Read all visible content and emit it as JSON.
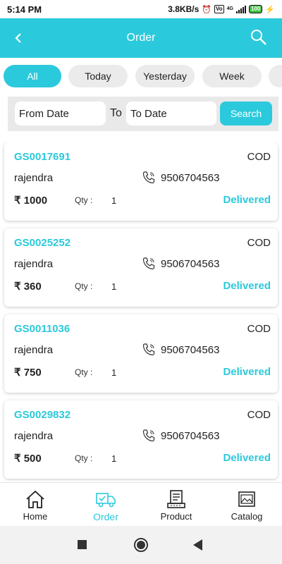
{
  "status_bar": {
    "time": "5:14 PM",
    "network_speed": "3.8KB/s",
    "volte": "Vo",
    "network": "4G",
    "battery": "100"
  },
  "app_bar": {
    "title": "Order",
    "back_icon": "arrow-left-icon",
    "search_icon": "search-icon"
  },
  "filters": [
    "All",
    "Today",
    "Yesterday",
    "Week"
  ],
  "date_filter": {
    "from_placeholder": "From Date",
    "to_separator": "To",
    "to_placeholder": "To Date",
    "search_label": "Search"
  },
  "orders": [
    {
      "id": "GS0017691",
      "payment": "COD",
      "customer": "rajendra",
      "phone": "9506704563",
      "amount": "₹ 1000",
      "qty_label": "Qty :",
      "qty": "1",
      "status": "Delivered"
    },
    {
      "id": "GS0025252",
      "payment": "COD",
      "customer": "rajendra",
      "phone": "9506704563",
      "amount": "₹ 360",
      "qty_label": "Qty :",
      "qty": "1",
      "status": "Delivered"
    },
    {
      "id": "GS0011036",
      "payment": "COD",
      "customer": "rajendra",
      "phone": "9506704563",
      "amount": "₹ 750",
      "qty_label": "Qty :",
      "qty": "1",
      "status": "Delivered"
    },
    {
      "id": "GS0029832",
      "payment": "COD",
      "customer": "rajendra",
      "phone": "9506704563",
      "amount": "₹ 500",
      "qty_label": "Qty :",
      "qty": "1",
      "status": "Delivered"
    }
  ],
  "bottom_nav": [
    {
      "label": "Home",
      "icon": "home-icon"
    },
    {
      "label": "Order",
      "icon": "delivery-truck-icon"
    },
    {
      "label": "Product",
      "icon": "product-box-icon"
    },
    {
      "label": "Catalog",
      "icon": "catalog-image-icon"
    }
  ],
  "colors": {
    "accent": "#2bc9dc",
    "chip_inactive": "#ebebeb",
    "date_bar_bg": "#e9e9e9"
  }
}
